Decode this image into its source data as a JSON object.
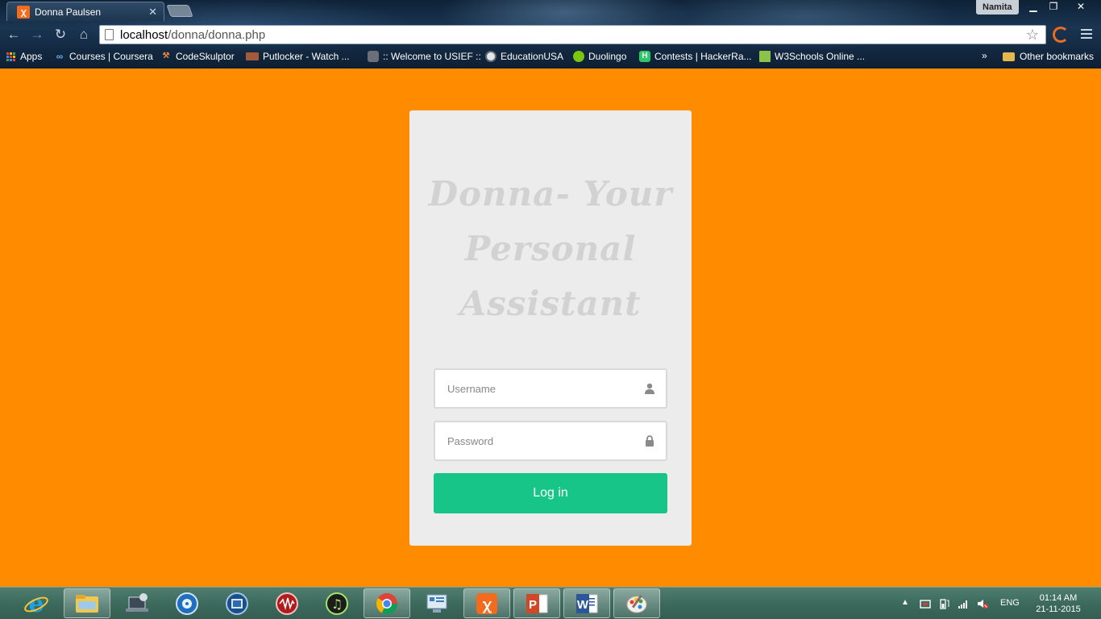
{
  "browser": {
    "tab_title": "Donna Paulsen",
    "tab_favicon": "xampp-icon",
    "profile_name": "Namita",
    "url_host": "localhost",
    "url_path": "/donna/donna.php",
    "bookmarks": [
      {
        "label": "Apps",
        "icon": "apps-grid-icon"
      },
      {
        "label": "Courses | Coursera",
        "icon": "coursera-icon"
      },
      {
        "label": "CodeSkulptor",
        "icon": "codeskulptor-icon"
      },
      {
        "label": "Putlocker - Watch ...",
        "icon": "putlocker-icon"
      },
      {
        "label": ":: Welcome to USIEF ::",
        "icon": "usief-icon"
      },
      {
        "label": "EducationUSA",
        "icon": "educationusa-icon"
      },
      {
        "label": "Duolingo",
        "icon": "duolingo-icon"
      },
      {
        "label": "Contests | HackerRa...",
        "icon": "hackerrank-icon"
      },
      {
        "label": "W3Schools Online ...",
        "icon": "w3schools-icon"
      }
    ],
    "overflow_chevron": "»",
    "other_bookmarks": "Other bookmarks"
  },
  "page": {
    "title_lines": [
      "Donna- Your",
      "Personal",
      "Assistant"
    ],
    "username_placeholder": "Username",
    "password_placeholder": "Password",
    "login_label": "Log in",
    "colors": {
      "background": "#ff8c00",
      "card": "#ececec",
      "button": "#17c589"
    }
  },
  "taskbar": {
    "apps": [
      "internet-explorer-icon",
      "file-explorer-icon",
      "device-setup-icon",
      "dvd-player-icon",
      "media-player-icon",
      "audio-recorder-icon",
      "itunes-icon",
      "chrome-icon",
      "control-panel-icon",
      "xampp-icon",
      "powerpoint-icon",
      "word-icon",
      "paint-icon"
    ],
    "language": "ENG",
    "time": "01:14 AM",
    "date": "21-11-2015"
  }
}
